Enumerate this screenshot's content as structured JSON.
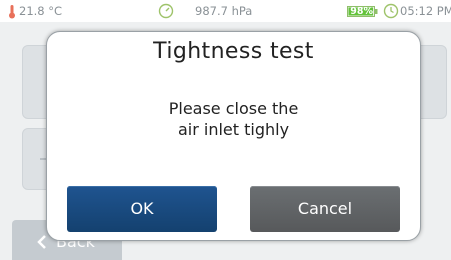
{
  "status_bar": {
    "temperature": "21.8 °C",
    "pressure": "987.7 hPa",
    "battery": "98%",
    "battery_level": 0.98,
    "time": "05:12 PM",
    "icons": [
      "thermometer-icon",
      "gauge-icon",
      "battery-icon",
      "clock-icon"
    ]
  },
  "background": {
    "back_label": "Back"
  },
  "dialog": {
    "title": "Tightness test",
    "message_line1": "Please close the",
    "message_line2": "air inlet tighly",
    "ok_label": "OK",
    "cancel_label": "Cancel"
  },
  "colors": {
    "ok_button": "#1b4c84",
    "cancel_button": "#636668",
    "battery_fill": "#63c33a",
    "thermometer": "#e8705a",
    "status_icons": "#9ec36a"
  }
}
